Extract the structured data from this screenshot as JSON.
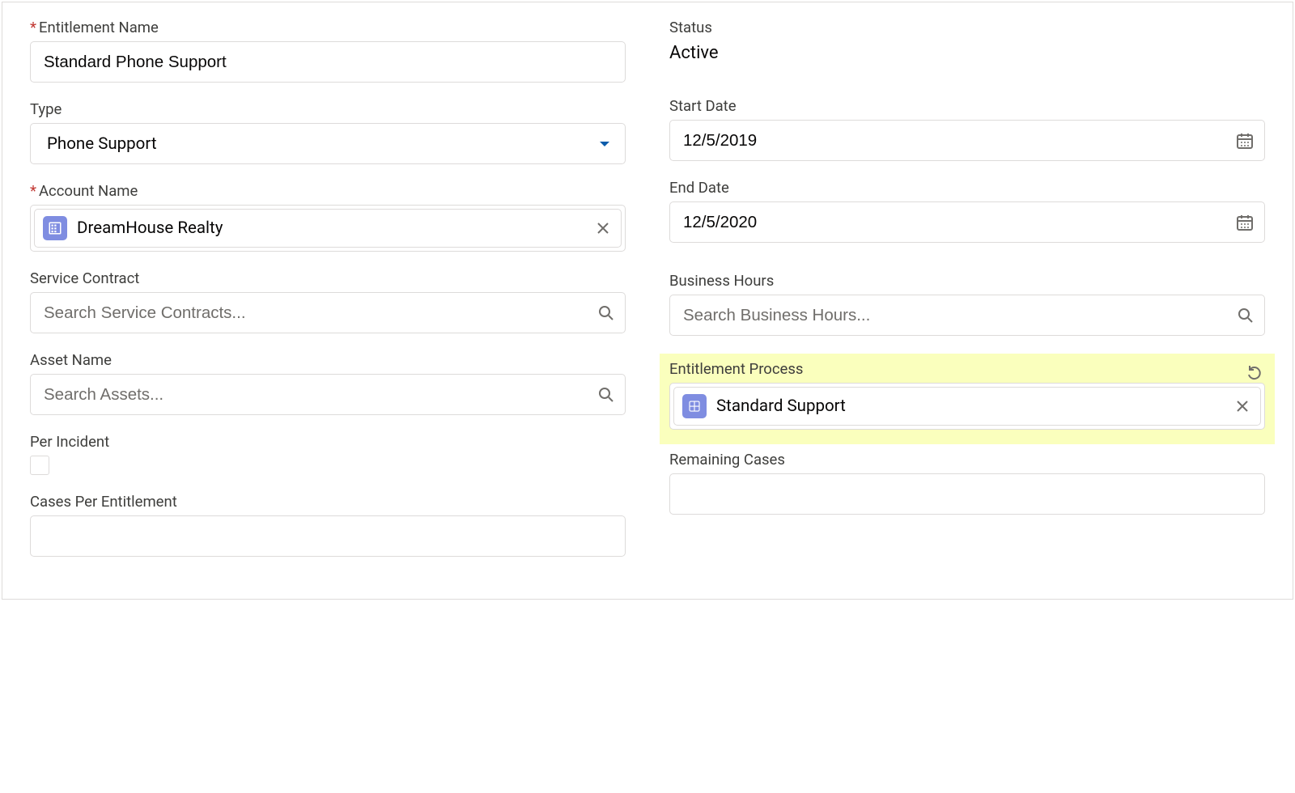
{
  "left": {
    "entitlement_name": {
      "label": "Entitlement Name",
      "value": "Standard Phone Support"
    },
    "type": {
      "label": "Type",
      "value": "Phone Support"
    },
    "account_name": {
      "label": "Account Name",
      "value": "DreamHouse Realty"
    },
    "service_contract": {
      "label": "Service Contract",
      "placeholder": "Search Service Contracts..."
    },
    "asset_name": {
      "label": "Asset Name",
      "placeholder": "Search Assets..."
    },
    "per_incident": {
      "label": "Per Incident"
    },
    "cases_per_entitlement": {
      "label": "Cases Per Entitlement"
    }
  },
  "right": {
    "status": {
      "label": "Status",
      "value": "Active"
    },
    "start_date": {
      "label": "Start Date",
      "value": "12/5/2019"
    },
    "end_date": {
      "label": "End Date",
      "value": "12/5/2020"
    },
    "business_hours": {
      "label": "Business Hours",
      "placeholder": "Search Business Hours..."
    },
    "entitlement_process": {
      "label": "Entitlement Process",
      "value": "Standard Support"
    },
    "remaining_cases": {
      "label": "Remaining Cases"
    }
  }
}
